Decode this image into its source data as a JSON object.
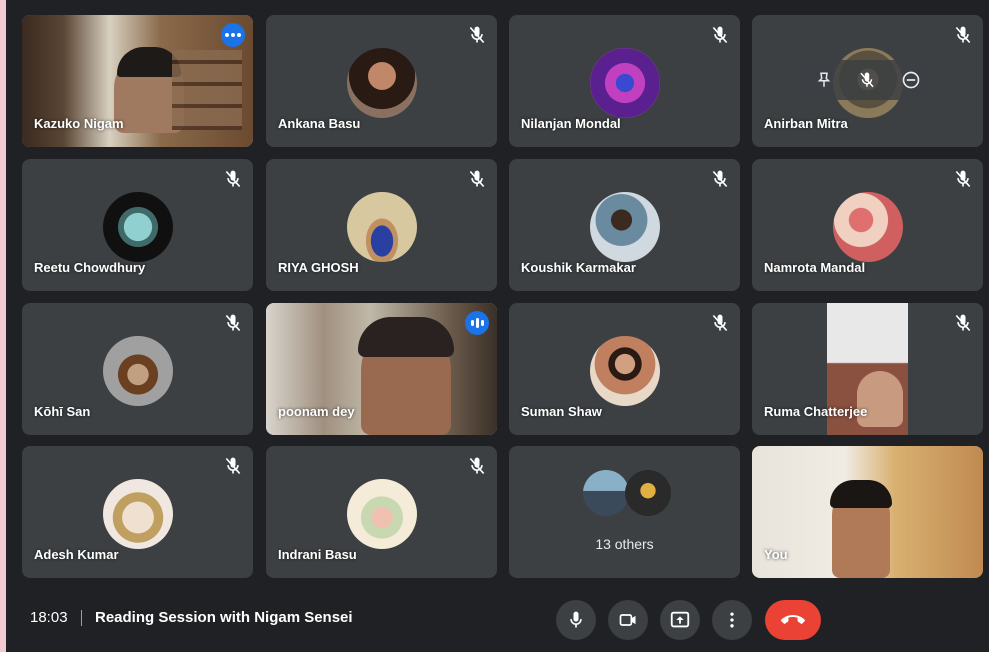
{
  "participants": [
    {
      "name": "Kazuko Nigam"
    },
    {
      "name": "Ankana Basu"
    },
    {
      "name": "Nilanjan Mondal"
    },
    {
      "name": "Anirban Mitra"
    },
    {
      "name": "Reetu Chowdhury"
    },
    {
      "name": "RIYA GHOSH"
    },
    {
      "name": "Koushik Karmakar"
    },
    {
      "name": "Namrota Mandal"
    },
    {
      "name": "Kōhī San"
    },
    {
      "name": "poonam dey"
    },
    {
      "name": "Suman Shaw"
    },
    {
      "name": "Ruma Chatterjee"
    },
    {
      "name": "Adesh Kumar"
    },
    {
      "name": "Indrani Basu"
    },
    {
      "name": "You"
    }
  ],
  "others": {
    "label": "13 others"
  },
  "footer": {
    "time": "18:03",
    "meeting_title": "Reading Session with Nigam Sensei"
  },
  "colors": {
    "accent": "#1a73e8",
    "end_call": "#ea4335",
    "tile": "#3c4043",
    "background": "#202124"
  }
}
